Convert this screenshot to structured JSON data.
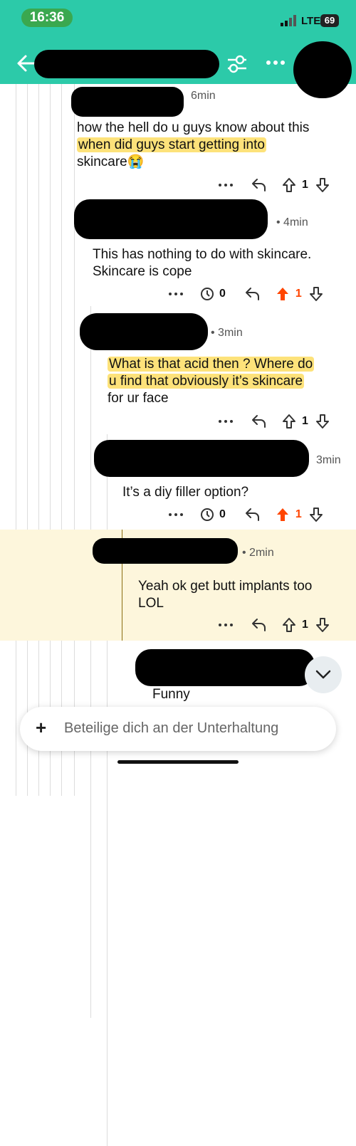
{
  "status_bar": {
    "time": "16:36",
    "network": "LTE",
    "battery": "69"
  },
  "header": {
    "back_icon": "arrow-left-icon",
    "filter_icon": "filter-icon",
    "more_icon": "more-dots-icon"
  },
  "comments": [
    {
      "id": "c1",
      "time": "6min",
      "lines": [
        "how the hell do u guys know about this",
        "when did guys start getting into",
        "skincare😭"
      ],
      "vote_count": "1",
      "upvoted": false
    },
    {
      "id": "c2",
      "time": "• 4min",
      "lines": [
        "This has nothing to do with skincare.",
        "Skincare is cope"
      ],
      "award_count": "0",
      "vote_count": "1",
      "upvoted": true
    },
    {
      "id": "c3",
      "time": "• 3min",
      "lines": [
        "What is that acid then ? Where do",
        "u find that obviously it’s skincare",
        "for ur face"
      ],
      "vote_count": "1",
      "upvoted": false
    },
    {
      "id": "c4",
      "time": "3min",
      "lines": [
        "It’s a diy filler option?"
      ],
      "award_count": "0",
      "vote_count": "1",
      "upvoted": true
    },
    {
      "id": "c5",
      "time": "• 2min",
      "lines": [
        "Yeah ok get butt implants too",
        "LOL"
      ],
      "vote_count": "1",
      "upvoted": false
    },
    {
      "id": "c6",
      "time": "",
      "lines": [
        "Funny"
      ]
    }
  ],
  "bottom": {
    "plus": "+",
    "placeholder": "Beteilige dich an der Unterhaltung"
  },
  "colors": {
    "header": "#2ccaa9",
    "upvote_active": "#ff4500",
    "highlight": "#fde27a",
    "selected_row": "#fdf6dc"
  }
}
